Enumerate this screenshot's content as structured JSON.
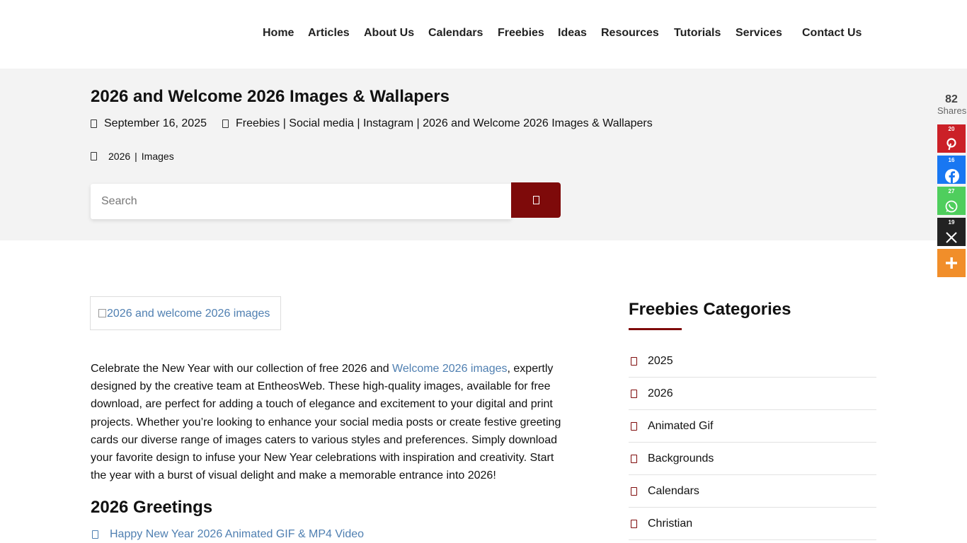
{
  "nav": {
    "items": [
      "Home",
      "Articles",
      "About Us",
      "Calendars",
      "Freebies",
      "Ideas",
      "Resources",
      "Tutorials",
      "Services",
      "Contact Us"
    ]
  },
  "post": {
    "title": "2026 and Welcome 2026 Images & Wallapers",
    "date": "September 16, 2025",
    "breadcrumb": "Freebies | Social media | Instagram | 2026 and Welcome 2026 Images & Wallapers",
    "tags": [
      "2026",
      "Images"
    ],
    "tag_separator": "|"
  },
  "search": {
    "placeholder": "Search"
  },
  "share": {
    "total": "82",
    "label": "Shares",
    "buttons": [
      {
        "network": "pinterest",
        "count": "20",
        "color": "#cb2027",
        "icon": "pinterest-icon"
      },
      {
        "network": "facebook",
        "count": "16",
        "color": "#1877f2",
        "icon": "facebook-icon"
      },
      {
        "network": "whatsapp",
        "count": "27",
        "color": "#4fce5d",
        "icon": "whatsapp-icon"
      },
      {
        "network": "x",
        "count": "19",
        "color": "#222222",
        "icon": "x-icon"
      },
      {
        "network": "more",
        "count": "",
        "color": "#f18e2a",
        "icon": "plus-icon"
      }
    ]
  },
  "content": {
    "image_alt": "2026 and welcome 2026 images",
    "intro_before_link": "Celebrate the New Year with our collection of free 2026 and ",
    "intro_link": "Welcome 2026 images",
    "intro_after_link": ", expertly designed by the creative team at EntheosWeb. These high-quality images, available for free download, are perfect for adding a touch of elegance and excitement to your digital and print projects. Whether you’re looking to enhance your social media posts or create festive greeting cards our diverse range of images caters to various styles and preferences. Simply download your favorite design to infuse your New Year celebrations with inspiration and creativity. Start the year with a burst of visual delight and make a memorable entrance into 2026!",
    "section_heading": "2026 Greetings",
    "greeting_link": "Happy New Year 2026 Animated GIF & MP4 Video"
  },
  "sidebar": {
    "title": "Freebies Categories",
    "categories": [
      "2025",
      "2026",
      "Animated Gif",
      "Backgrounds",
      "Calendars",
      "Christian"
    ]
  },
  "colors": {
    "accent": "#7e0a0a",
    "link": "#4f7fb1",
    "hero_bg": "#f3f3f3"
  }
}
